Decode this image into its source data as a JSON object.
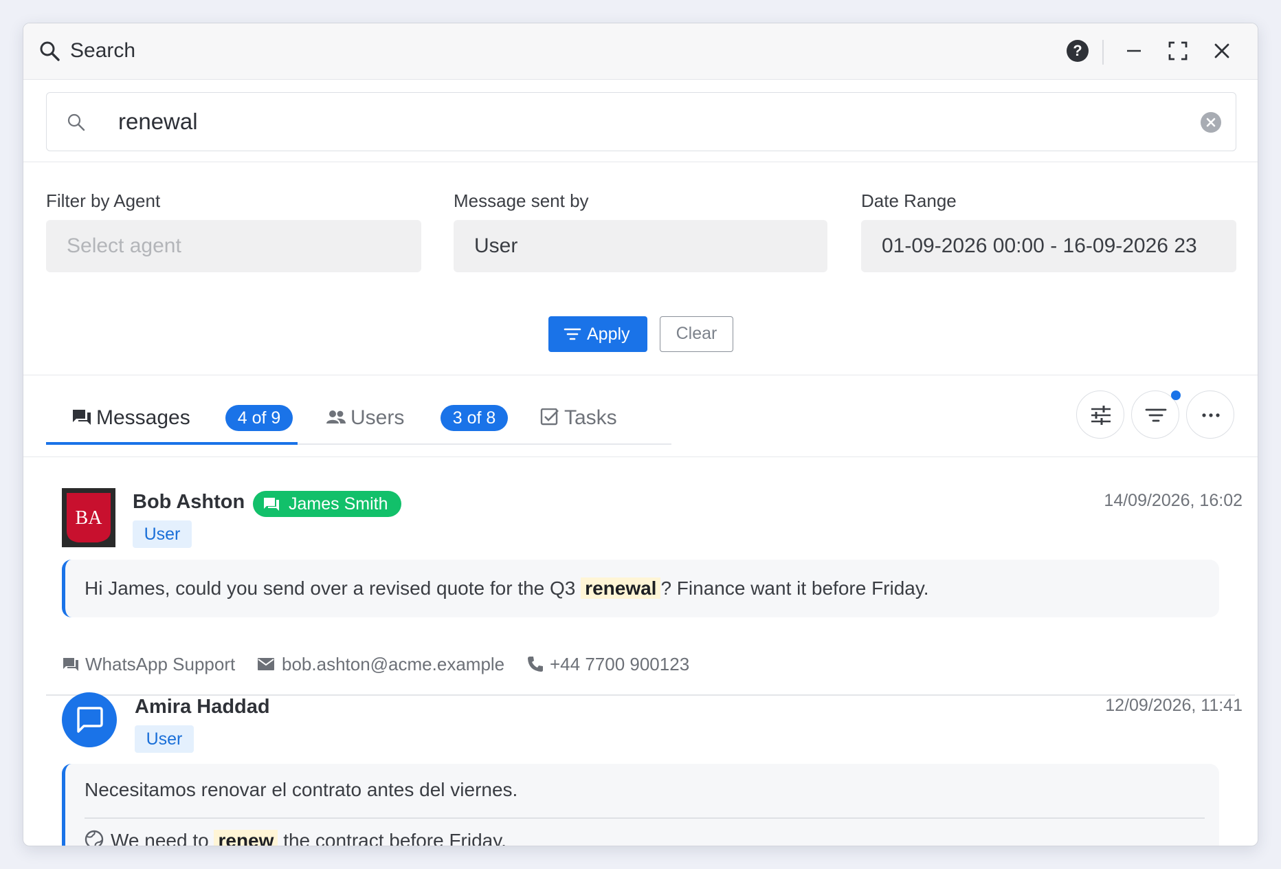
{
  "titlebar": {
    "title": "Search",
    "icons": [
      "search-icon",
      "help-icon",
      "minimize-icon",
      "fullscreen-icon",
      "close-icon"
    ]
  },
  "search": {
    "value": "renewal",
    "placeholder": ""
  },
  "filters": {
    "agent": {
      "label": "Filter by Agent",
      "placeholder": "Select agent",
      "value": ""
    },
    "sender": {
      "label": "Message sent by",
      "value": "User"
    },
    "date": {
      "label": "Date Range",
      "value": "01-09-2026 00:00 - 16-09-2026 23"
    },
    "apply_label": "Apply",
    "clear_label": "Clear"
  },
  "tabs": [
    {
      "label": "Messages",
      "count": "4 of 9",
      "icon": "messages-icon",
      "active": true
    },
    {
      "label": "Users",
      "count": "3 of 8",
      "icon": "users-icon",
      "active": false
    },
    {
      "label": "Tasks",
      "icon": "tasks-icon",
      "active": false
    }
  ],
  "toolbar_icons": [
    "sliders-icon",
    "filter-icon",
    "more-icon"
  ],
  "results": [
    {
      "avatar_initials": "BA",
      "name": "Bob Ashton",
      "agent": "James Smith",
      "role": "User",
      "time": "14/09/2026, 16:02",
      "text_before": "Hi James, could you send over a revised quote for the Q3 ",
      "highlight": "renewal",
      "text_after": "? Finance want it before Friday.",
      "channel": "WhatsApp Support",
      "email": "bob.ashton@acme.example",
      "phone": "+44 7700 900123"
    },
    {
      "name": "Amira Haddad",
      "role": "User",
      "time": "12/09/2026, 11:41",
      "text": "Necesitamos renovar el contrato antes del viernes.",
      "translation_before": "We need to ",
      "translation_highlight": "renew",
      "translation_after": " the contract before Friday."
    }
  ],
  "colors": {
    "accent": "#1a73e8",
    "agent_badge": "#12c06a",
    "highlight_bg": "#fff5d6",
    "avatar_ba": "#c8102e"
  }
}
